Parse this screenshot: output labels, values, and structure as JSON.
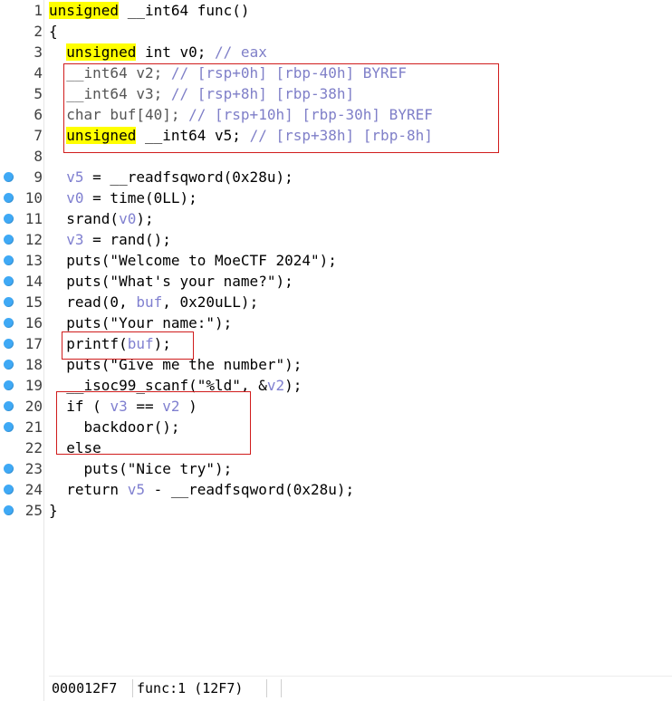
{
  "lines": [
    {
      "num": "1",
      "bp": false
    },
    {
      "num": "2",
      "bp": false
    },
    {
      "num": "3",
      "bp": false
    },
    {
      "num": "4",
      "bp": false
    },
    {
      "num": "5",
      "bp": false
    },
    {
      "num": "6",
      "bp": false
    },
    {
      "num": "7",
      "bp": false
    },
    {
      "num": "8",
      "bp": false
    },
    {
      "num": "9",
      "bp": true
    },
    {
      "num": "10",
      "bp": true
    },
    {
      "num": "11",
      "bp": true
    },
    {
      "num": "12",
      "bp": true
    },
    {
      "num": "13",
      "bp": true
    },
    {
      "num": "14",
      "bp": true
    },
    {
      "num": "15",
      "bp": true
    },
    {
      "num": "16",
      "bp": true
    },
    {
      "num": "17",
      "bp": true
    },
    {
      "num": "18",
      "bp": true
    },
    {
      "num": "19",
      "bp": true
    },
    {
      "num": "20",
      "bp": true
    },
    {
      "num": "21",
      "bp": true
    },
    {
      "num": "22",
      "bp": false
    },
    {
      "num": "23",
      "bp": true
    },
    {
      "num": "24",
      "bp": true
    },
    {
      "num": "25",
      "bp": true
    }
  ],
  "code": {
    "l1_kw": "unsigned",
    "l1_rest": " __int64 func()",
    "l2": "{",
    "l3_kw": "unsigned",
    "l3_rest": " int v0; ",
    "l3_cmt": "// eax",
    "l4_code": "__int64 v2; ",
    "l4_cmt": "// [rsp+0h] [rbp-40h] BYREF",
    "l5_code": "__int64 v3; ",
    "l5_cmt": "// [rsp+8h] [rbp-38h]",
    "l6_code": "char buf[40]; ",
    "l6_cmt": "// [rsp+10h] [rbp-30h] BYREF",
    "l7_kw": "unsigned",
    "l7_rest": " __int64 v5; ",
    "l7_cmt": "// [rsp+38h] [rbp-8h]",
    "l8": "",
    "l9_v": "v5",
    "l9_rest": " = __readfsqword(0x28u);",
    "l10_v": "v0",
    "l10_rest": " = time(0LL);",
    "l11_a": "srand(",
    "l11_v": "v0",
    "l11_b": ");",
    "l12_v": "v3",
    "l12_rest": " = rand();",
    "l13": "puts(\"Welcome to MoeCTF 2024\");",
    "l14": "puts(\"What's your name?\");",
    "l15_a": "read(0, ",
    "l15_v": "buf",
    "l15_b": ", 0x20uLL);",
    "l16": "puts(\"Your name:\");",
    "l17_a": "printf(",
    "l17_v": "buf",
    "l17_b": ");",
    "l18": "puts(\"Give me the number\");",
    "l19_a": "__isoc99_scanf(\"%ld\", &",
    "l19_v": "v2",
    "l19_b": ");",
    "l20_a": "if ( ",
    "l20_v1": "v3",
    "l20_m": " == ",
    "l20_v2": "v2",
    "l20_b": " )",
    "l21": "backdoor();",
    "l22": "else",
    "l23": "puts(\"Nice try\");",
    "l24_a": "return ",
    "l24_v": "v5",
    "l24_b": " - __readfsqword(0x28u);",
    "l25": "}"
  },
  "status": {
    "address": "000012F7",
    "location": "func:1 (12F7)"
  }
}
